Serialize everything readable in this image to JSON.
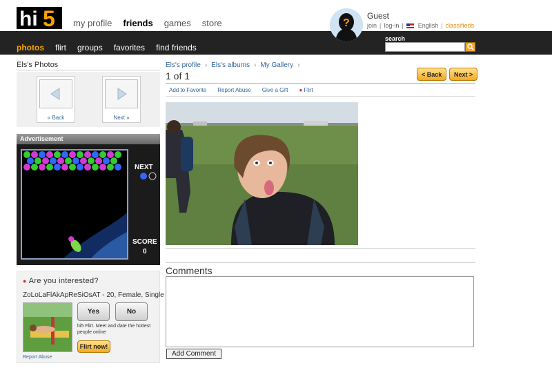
{
  "header": {
    "logo_text": "hi5",
    "nav": [
      {
        "label": "my profile",
        "active": false
      },
      {
        "label": "friends",
        "active": true
      },
      {
        "label": "games",
        "active": false
      },
      {
        "label": "store",
        "active": false
      }
    ],
    "guest": {
      "name": "Guest",
      "join": "join",
      "login": "log-in",
      "language": "English",
      "classifieds": "classifieds"
    }
  },
  "subnav": {
    "items": [
      {
        "label": "photos",
        "active": true
      },
      {
        "label": "flirt",
        "active": false
      },
      {
        "label": "groups",
        "active": false
      },
      {
        "label": "favorites",
        "active": false
      },
      {
        "label": "find friends",
        "active": false
      }
    ],
    "search_label": "search",
    "search_value": ""
  },
  "left": {
    "title": "Els's Photos",
    "back_label": "« Back",
    "next_label": "Next »",
    "ad": {
      "header": "Advertisement",
      "next": "NEXT",
      "score_label": "SCORE",
      "score_value": "0"
    },
    "interest": {
      "title": "Are you interested?",
      "user": "ZoLoLaFlAkApReSiOsAT - 20, Female, Single",
      "yes": "Yes",
      "no": "No",
      "desc": "hi5 Flirt. Meet and date the hottest people online",
      "flirt_now": "Flirt now!",
      "report": "Report Abuse"
    }
  },
  "main": {
    "breadcrumb": [
      "Els's profile",
      "Els's albums",
      "My Gallery"
    ],
    "pager": "1 of 1",
    "back_button": "< Back",
    "next_button": "Next >",
    "actions": {
      "favorite": "Add to Favorite",
      "report": "Report Abuse",
      "gift": "Give a Gift",
      "flirt": "Flirt"
    },
    "comments_title": "Comments",
    "comment_value": "",
    "add_comment": "Add Comment"
  },
  "colors": {
    "accent_orange": "#f7a300",
    "navbar": "#232323",
    "link": "#336699"
  }
}
